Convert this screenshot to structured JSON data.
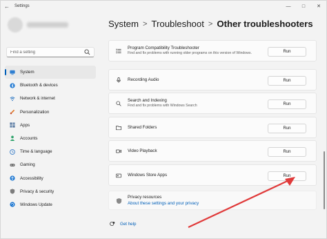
{
  "window": {
    "title": "Settings"
  },
  "search": {
    "placeholder": "Find a setting"
  },
  "sidebar": {
    "items": [
      {
        "label": "System",
        "icon": "monitor-icon",
        "active": true
      },
      {
        "label": "Bluetooth & devices",
        "icon": "bluetooth-icon"
      },
      {
        "label": "Network & internet",
        "icon": "wifi-icon"
      },
      {
        "label": "Personalization",
        "icon": "brush-icon"
      },
      {
        "label": "Apps",
        "icon": "apps-icon"
      },
      {
        "label": "Accounts",
        "icon": "person-icon"
      },
      {
        "label": "Time & language",
        "icon": "globe-clock-icon"
      },
      {
        "label": "Gaming",
        "icon": "gamepad-icon"
      },
      {
        "label": "Accessibility",
        "icon": "accessibility-icon"
      },
      {
        "label": "Privacy & security",
        "icon": "shield-icon"
      },
      {
        "label": "Windows Update",
        "icon": "update-icon"
      }
    ]
  },
  "breadcrumb": {
    "items": [
      "System",
      "Troubleshoot",
      "Other troubleshooters"
    ],
    "separator": ">"
  },
  "troubleshooters": [
    {
      "label": "Program Compatibility Troubleshooter",
      "desc": "Find and fix problems with running older programs on this version of Windows.",
      "run": "Run",
      "icon": "list-icon"
    },
    {
      "label": "Recording Audio",
      "desc": "",
      "run": "Run",
      "icon": "microphone-icon"
    },
    {
      "label": "Search and Indexing",
      "desc": "Find and fix problems with Windows Search",
      "run": "Run",
      "icon": "search-icon"
    },
    {
      "label": "Shared Folders",
      "desc": "",
      "run": "Run",
      "icon": "folder-icon"
    },
    {
      "label": "Video Playback",
      "desc": "",
      "run": "Run",
      "icon": "video-icon"
    },
    {
      "label": "Windows Store Apps",
      "desc": "",
      "run": "Run",
      "icon": "store-icon"
    }
  ],
  "privacy": {
    "title": "Privacy resources",
    "link": "About these settings and your privacy"
  },
  "help": {
    "label": "Get help"
  },
  "colors": {
    "accent": "#005fb8",
    "annotation_arrow": "#e03a3a"
  }
}
